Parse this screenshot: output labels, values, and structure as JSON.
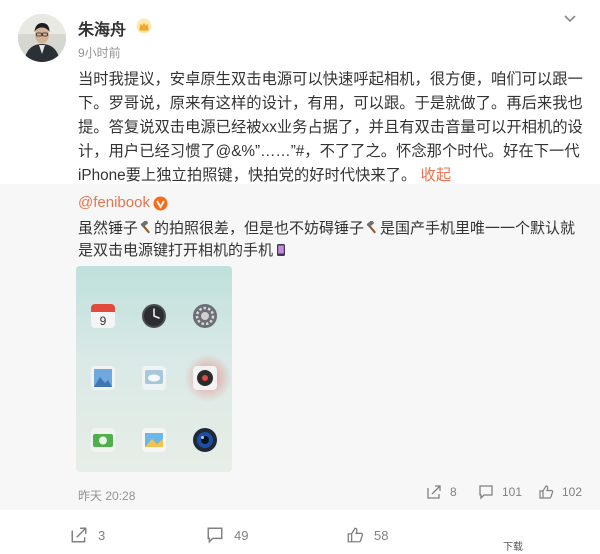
{
  "post": {
    "username": "朱海舟",
    "time": "9小时前",
    "text": "当时我提议，安卓原生双击电源可以快速呼起相机，很方便，咱们可以跟一下。罗哥说，原来有这样的设计，有用，可以跟。于是就做了。再后来我也提。答复说双击电源已经被xx业务占据了，并且有双击音量可以开相机的设计，用户已经习惯了@&%”……”#，不了了之。怀念那个时代。好在下一代iPhone要上独立拍照键，快拍党的好时代快来了。",
    "collapse_label": "收起"
  },
  "repost": {
    "username": "@fenibook",
    "text_part1": "虽然锤子",
    "text_part2": "的拍照很差，但是也不妨碍锤子",
    "text_part3": "是国产手机里唯一一个默认就是双击电源键打开相机的手机",
    "time": "昨天 20:28",
    "repost_count": "8",
    "comment_count": "101",
    "like_count": "102"
  },
  "stats": {
    "repost_count": "3",
    "comment_count": "49",
    "like_count": "58",
    "download_label": "下载"
  },
  "colors": {
    "accent": "#eb7350",
    "meta_gray": "#939393",
    "repost_bg": "#f7f7f7"
  },
  "icons": [
    "avatar",
    "crown-icon",
    "chevron-down-icon",
    "verified-badge-icon",
    "hammer-emoji-icon",
    "phone-emoji-icon",
    "repost-icon",
    "comment-icon",
    "like-icon"
  ]
}
